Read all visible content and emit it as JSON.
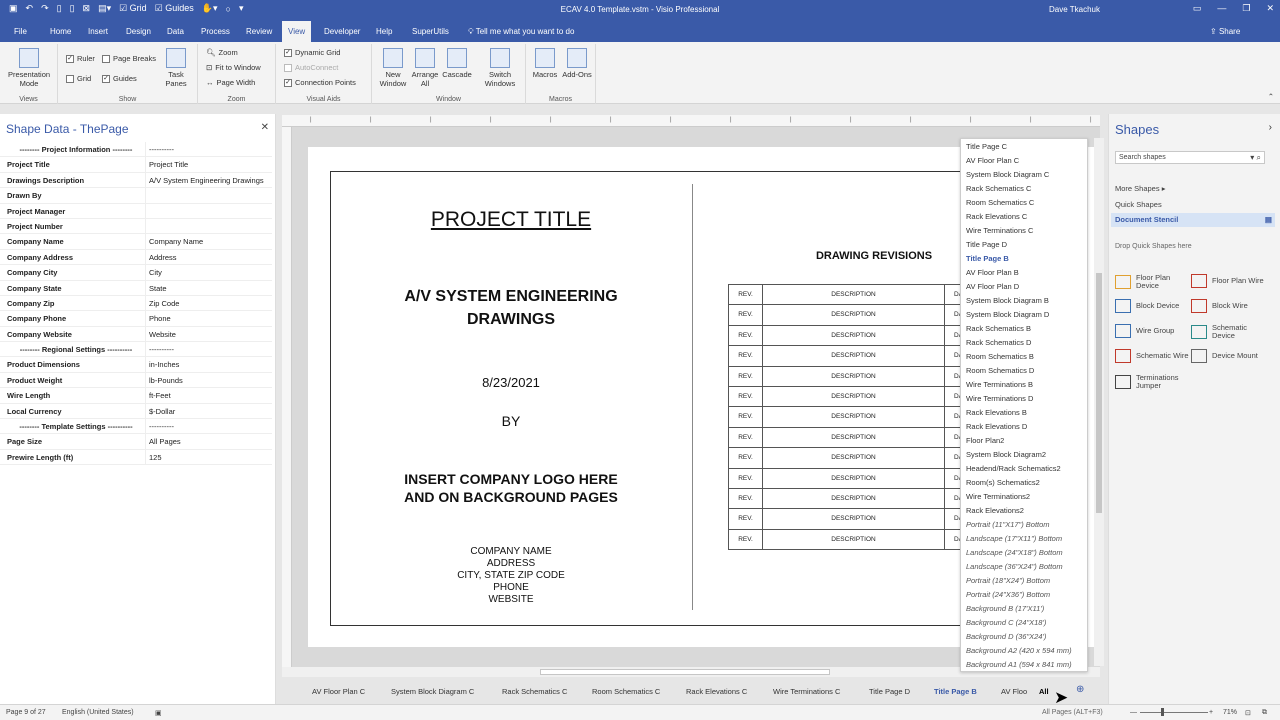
{
  "window": {
    "title": "ECAV 4.0 Template.vstm - Visio Professional",
    "user": "Dave Tkachuk",
    "qat_grid": "Grid",
    "qat_guides": "Guides"
  },
  "menu": {
    "tabs": [
      "File",
      "Home",
      "Insert",
      "Design",
      "Data",
      "Process",
      "Review",
      "View",
      "Developer",
      "Help",
      "SuperUtils"
    ],
    "active": "View",
    "tell_me": "Tell me what you want to do",
    "share": "Share"
  },
  "ribbon": {
    "views": {
      "presentation_mode": "Presentation Mode",
      "label": "Views"
    },
    "show": {
      "ruler": "Ruler",
      "page_breaks": "Page Breaks",
      "grid": "Grid",
      "guides": "Guides",
      "task_panes": "Task Panes",
      "label": "Show"
    },
    "zoom": {
      "zoom": "Zoom",
      "fit": "Fit to Window",
      "page_width": "Page Width",
      "label": "Zoom"
    },
    "visual_aids": {
      "dynamic_grid": "Dynamic Grid",
      "autoconnect": "AutoConnect",
      "connection_points": "Connection Points",
      "label": "Visual Aids"
    },
    "window": {
      "new_window": "New Window",
      "arrange_all": "Arrange All",
      "cascade": "Cascade",
      "switch_windows": "Switch Windows",
      "label": "Window"
    },
    "macros": {
      "macros": "Macros",
      "addons": "Add-Ons",
      "label": "Macros"
    }
  },
  "shape_data": {
    "title": "Shape Data - ThePage",
    "rows": [
      {
        "k": "-------- Project Information --------",
        "v": "----------",
        "section": true
      },
      {
        "k": "Project Title",
        "v": "Project Title"
      },
      {
        "k": "Drawings Description",
        "v": "A/V System Engineering Drawings"
      },
      {
        "k": "Drawn By",
        "v": ""
      },
      {
        "k": "Project Manager",
        "v": ""
      },
      {
        "k": "Project Number",
        "v": ""
      },
      {
        "k": "Company Name",
        "v": "Company Name"
      },
      {
        "k": "Company Address",
        "v": "Address"
      },
      {
        "k": "Company City",
        "v": "City"
      },
      {
        "k": "Company State",
        "v": "State"
      },
      {
        "k": "Company Zip",
        "v": "Zip Code"
      },
      {
        "k": "Company Phone",
        "v": "Phone"
      },
      {
        "k": "Company Website",
        "v": "Website"
      },
      {
        "k": "-------- Regional Settings ----------",
        "v": "----------",
        "section": true
      },
      {
        "k": "Product Dimensions",
        "v": "in-Inches"
      },
      {
        "k": "Product Weight",
        "v": "lb-Pounds"
      },
      {
        "k": "Wire Length",
        "v": "ft-Feet"
      },
      {
        "k": "Local Currency",
        "v": "$-Dollar"
      },
      {
        "k": "-------- Template Settings ----------",
        "v": "----------",
        "section": true
      },
      {
        "k": "Page Size",
        "v": "All Pages"
      },
      {
        "k": "Prewire Length (ft)",
        "v": "125"
      }
    ]
  },
  "drawing": {
    "project_title": "PROJECT TITLE",
    "subtitle_1": "A/V SYSTEM ENGINEERING",
    "subtitle_2": "DRAWINGS",
    "date": "8/23/2021",
    "by": "BY",
    "logo_1": "INSERT COMPANY LOGO HERE",
    "logo_2": "AND ON BACKGROUND PAGES",
    "company_name": "COMPANY NAME",
    "address": "ADDRESS",
    "city_line": "CITY, STATE  ZIP CODE",
    "phone": "PHONE",
    "website": "WEBSITE",
    "revisions_title": "DRAWING REVISIONS",
    "rev_label": "REV.",
    "desc_label": "DESCRIPTION",
    "date_partial": "DA",
    "rev_row_count": 13
  },
  "page_list": {
    "items": [
      "Title Page C",
      "AV Floor Plan C",
      "System Block Diagram C",
      "Rack Schematics C",
      "Room Schematics C",
      "Rack Elevations C",
      "Wire Terminations C",
      "Title Page D",
      "Title Page B",
      "AV Floor Plan B",
      "AV Floor Plan D",
      "System Block Diagram B",
      "System Block Diagram D",
      "Rack Schematics B",
      "Rack Schematics D",
      "Room Schematics B",
      "Room Schematics D",
      "Wire Terminations B",
      "Wire Terminations D",
      "Rack Elevations B",
      "Rack Elevations D",
      "Floor Plan2",
      "System Block Diagram2",
      "Headend/Rack Schematics2",
      "Room(s) Schematics2",
      "Wire Terminations2",
      "Rack Elevations2",
      "Portrait (11\"X17\") Bottom",
      "Landscape (17\"X11\") Bottom",
      "Landscape (24\"X18\") Bottom",
      "Landscape (36\"X24\") Bottom",
      "Portrait (18\"X24\") Bottom",
      "Portrait (24\"X36\") Bottom",
      "Background B (17'X11')",
      "Background C (24\"X18')",
      "Background D (36\"X24')",
      "Background A2 (420 x 594 mm)",
      "Background A1 (594 x 841 mm)"
    ],
    "active": "Title Page B"
  },
  "page_tabs": {
    "tabs": [
      "AV Floor Plan C",
      "System Block Diagram C",
      "Rack Schematics C",
      "Room Schematics C",
      "Rack Elevations C",
      "Wire Terminations C",
      "Title Page D",
      "Title Page B",
      "AV Floo"
    ],
    "active": "Title Page B",
    "all_label": "All",
    "tooltip": "All Pages (ALT+F3)"
  },
  "shapes": {
    "title": "Shapes",
    "search_placeholder": "Search shapes",
    "more_shapes": "More Shapes",
    "quick_shapes": "Quick Shapes",
    "document_stencil": "Document Stencil",
    "drop_hint": "Drop Quick Shapes here",
    "items": [
      {
        "label": "Floor Plan Device",
        "icon": "floor-plan-device-icon"
      },
      {
        "label": "Floor Plan Wire",
        "icon": "floor-plan-wire-icon"
      },
      {
        "label": "Block Device",
        "icon": "block-device-icon"
      },
      {
        "label": "Block Wire",
        "icon": "block-wire-icon"
      },
      {
        "label": "Wire Group",
        "icon": "wire-group-icon"
      },
      {
        "label": "Schematic Device",
        "icon": "schematic-device-icon"
      },
      {
        "label": "Schematic Wire",
        "icon": "schematic-wire-icon"
      },
      {
        "label": "Device Mount",
        "icon": "device-mount-icon"
      },
      {
        "label": "Terminations Jumper",
        "icon": "terminations-jumper-icon"
      }
    ]
  },
  "status": {
    "page": "Page 9 of 27",
    "language": "English (United States)",
    "zoom": "71%"
  },
  "colors": {
    "accent": "#3a5aa8",
    "ribbon": "#f3f3f3"
  }
}
